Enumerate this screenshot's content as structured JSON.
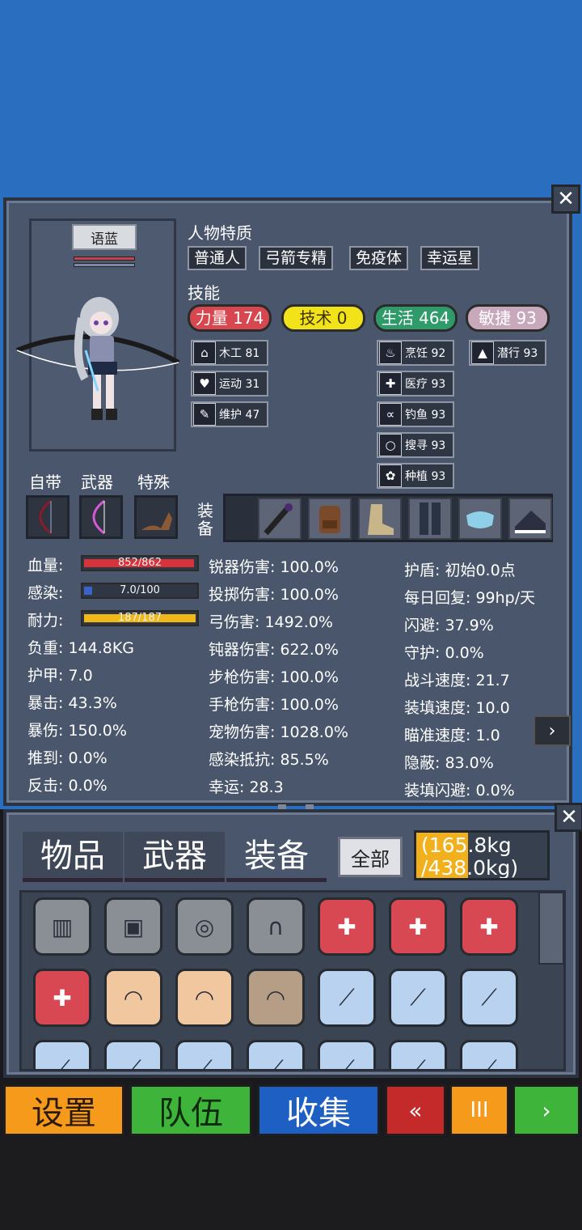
{
  "character": {
    "name": "语蓝",
    "traits_title": "人物特质",
    "traits": [
      "普通人",
      "弓箭专精",
      "免疫体",
      "幸运星"
    ],
    "skills_title": "技能",
    "skill_groups": [
      {
        "label": "力量 174",
        "color": "#d7474f"
      },
      {
        "label": "技术 0",
        "color": "#f2e21a"
      },
      {
        "label": "生活 464",
        "color": "#2f9a6a"
      },
      {
        "label": "敏捷 93",
        "color": "#c7a9bb"
      }
    ],
    "sub_skills": [
      {
        "label": "木工 81",
        "icon": "house-icon"
      },
      {
        "label": "运动 31",
        "icon": "heart-icon"
      },
      {
        "label": "维护 47",
        "icon": "wrench-icon"
      },
      {
        "label": "烹饪 92",
        "icon": "pot-icon"
      },
      {
        "label": "医疗 93",
        "icon": "medkit-icon"
      },
      {
        "label": "钓鱼 93",
        "icon": "fish-icon"
      },
      {
        "label": "搜寻 93",
        "icon": "magnifier-icon"
      },
      {
        "label": "种植 93",
        "icon": "plant-icon"
      },
      {
        "label": "潜行 93",
        "icon": "sneak-icon"
      }
    ],
    "slot_labels": {
      "innate": "自带",
      "weapon": "武器",
      "special": "特殊",
      "equip": "装备"
    },
    "bars": {
      "hp": {
        "label": "血量:",
        "text": "852/862",
        "ratio": 0.988,
        "color": "#d8333b"
      },
      "infection": {
        "label": "感染:",
        "text": "7.0/100",
        "ratio": 0.07,
        "color": "#3b63c9"
      },
      "stamina": {
        "label": "耐力:",
        "text": "187/187",
        "ratio": 1.0,
        "color": "#f0b818"
      }
    },
    "stats_left": [
      "负重: 144.8KG",
      "护甲: 7.0",
      "暴击: 43.3%",
      "暴伤: 150.0%",
      "推到: 0.0%",
      "反击: 0.0%"
    ],
    "stats_mid": [
      "锐器伤害: 100.0%",
      "投掷伤害: 100.0%",
      "弓伤害: 1492.0%",
      "钝器伤害: 622.0%",
      "步枪伤害: 100.0%",
      "手枪伤害: 100.0%",
      "宠物伤害: 1028.0%",
      "感染抵抗: 85.5%",
      "幸运: 28.3"
    ],
    "stats_right": [
      "护盾: 初始0.0点",
      "每日回复: 99hp/天",
      "闪避: 37.9%",
      "守护: 0.0%",
      "战斗速度: 21.7",
      "装填速度: 10.0",
      "瞄准速度: 1.0",
      "隐蔽: 83.0%",
      "装填闪避: 0.0%"
    ],
    "close_label": "✕",
    "next_label": "›"
  },
  "inventory": {
    "tabs": [
      "物品",
      "武器",
      "装备"
    ],
    "filter_label": "全部",
    "weight_text": "(165.8kg\n/438.0kg)",
    "weight_ratio": 0.378,
    "close_label": "✕",
    "items": [
      {
        "icon": "pants-icon",
        "bg": "gray"
      },
      {
        "icon": "backpack-icon",
        "bg": "gray"
      },
      {
        "icon": "sunglasses-icon",
        "bg": "gray"
      },
      {
        "icon": "headphones-icon",
        "bg": "gray"
      },
      {
        "icon": "medkit-icon",
        "bg": "red"
      },
      {
        "icon": "medkit-icon",
        "bg": "red"
      },
      {
        "icon": "medkit-icon",
        "bg": "red"
      },
      {
        "icon": "medkit-icon",
        "bg": "red"
      },
      {
        "icon": "mask-icon",
        "bg": "peach"
      },
      {
        "icon": "mask-icon",
        "bg": "peach"
      },
      {
        "icon": "mask-icon",
        "bg": "tan"
      },
      {
        "icon": "flashlight-icon",
        "bg": "blue"
      },
      {
        "icon": "flashlight-icon",
        "bg": "blue"
      },
      {
        "icon": "flashlight-icon",
        "bg": "blue"
      },
      {
        "icon": "flashlight-icon",
        "bg": "blue"
      },
      {
        "icon": "flashlight-icon",
        "bg": "blue"
      },
      {
        "icon": "flashlight-icon",
        "bg": "blue"
      },
      {
        "icon": "flashlight-icon",
        "bg": "blue"
      },
      {
        "icon": "flashlight-icon",
        "bg": "blue"
      },
      {
        "icon": "flashlight-icon",
        "bg": "blue"
      },
      {
        "icon": "flashlight-icon",
        "bg": "blue"
      }
    ]
  },
  "bottom_nav": [
    {
      "label": "设置",
      "style": "orange"
    },
    {
      "label": "队伍",
      "style": "green"
    },
    {
      "label": "收集",
      "style": "blue"
    },
    {
      "label": "«",
      "style": "red"
    },
    {
      "label": "III",
      "style": "orange2"
    },
    {
      "label": "›",
      "style": "green2"
    }
  ]
}
